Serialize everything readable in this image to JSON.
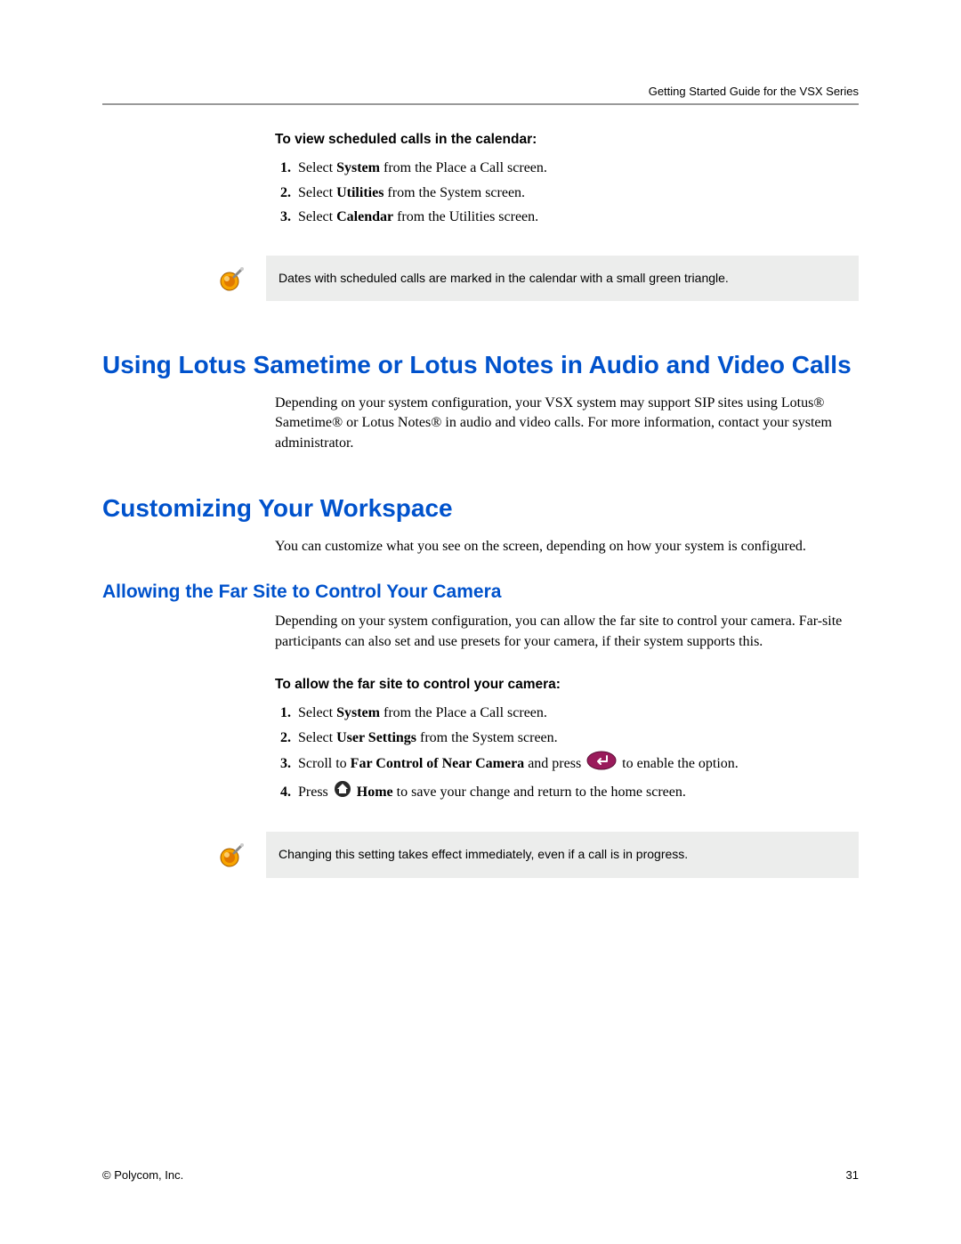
{
  "header": {
    "running_title": "Getting Started Guide for the VSX Series"
  },
  "section1": {
    "proc_heading": "To view scheduled calls in the calendar:",
    "step1_pre": "Select ",
    "step1_b": "System",
    "step1_post": " from the Place a Call screen.",
    "step2_pre": "Select ",
    "step2_b": "Utilities",
    "step2_post": " from the System screen.",
    "step3_pre": "Select ",
    "step3_b": "Calendar",
    "step3_post": " from the Utilities screen."
  },
  "note1": {
    "text": "Dates with scheduled calls are marked in the calendar with a small green triangle."
  },
  "h1a": "Using Lotus Sametime or Lotus Notes in Audio and Video Calls",
  "para1": "Depending on your system configuration, your VSX system may support SIP sites using Lotus® Sametime® or Lotus Notes® in audio and video calls. For more information, contact your system administrator.",
  "h1b": "Customizing Your Workspace",
  "para2": "You can customize what you see on the screen, depending on how your system is configured.",
  "h2a": "Allowing the Far Site to Control Your Camera",
  "para3": "Depending on your system configuration, you can allow the far site to control your camera. Far-site participants can also set and use presets for your camera, if their system supports this.",
  "section2": {
    "proc_heading": "To allow the far site to control your camera:",
    "step1_pre": "Select ",
    "step1_b": "System",
    "step1_post": " from the Place a Call screen.",
    "step2_pre": "Select ",
    "step2_b": "User Settings",
    "step2_post": " from the System screen.",
    "step3_pre": "Scroll to ",
    "step3_b": "Far Control of Near Camera",
    "step3_mid": " and press ",
    "step3_post": " to enable the option.",
    "step4_pre": "Press ",
    "step4_b": " Home",
    "step4_post": " to save your change and return to the home screen."
  },
  "note2": {
    "text": "Changing this setting takes effect immediately, even if a call is in progress."
  },
  "footer": {
    "left": "© Polycom, Inc.",
    "right": "31"
  }
}
